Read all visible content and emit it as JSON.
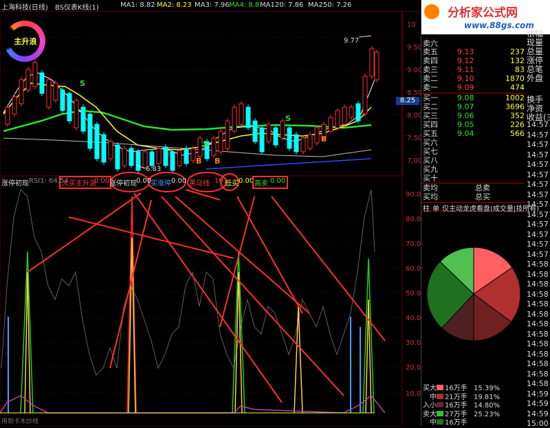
{
  "header": {
    "stock": "上海科技(日线)",
    "indicator": "BS仪表K线(1)",
    "ma1": "MA1: 8.82",
    "ma2": "MA2: 8.23",
    "ma3": "MA3: 7.96",
    "ma4": "MA4: 8.8",
    "ma120": "MA120: 7.86",
    "ma250": "MA250: 7.26"
  },
  "gauge_label": "主升浪",
  "chart_labels": {
    "high": "9.77",
    "low": "6.83",
    "current_price": "8.25",
    "signal_S": "S",
    "signal_B": "B"
  },
  "price_axis": [
    "10",
    "9.50",
    "9.00",
    "8.50",
    "8.00",
    "7.50",
    "7.00"
  ],
  "sub_header": {
    "title": "涨停初现",
    "rsi": "RSI1: 64.54",
    "labels": [
      {
        "text": "大买主升浪",
        "value": "0.00"
      },
      {
        "text": "涨停初现",
        "value": "0.00"
      },
      {
        "text": "买涨停",
        "value": "0.00"
      },
      {
        "text": "黑马线",
        "value": "10"
      },
      {
        "text": "低买",
        "value": "0.00"
      },
      {
        "text": "高卖",
        "value": "0.00"
      }
    ]
  },
  "rsi_axis": [
    "90.00",
    "80.00",
    "70.00",
    "60.00",
    "50.00",
    "40.00",
    "30.00",
    "20.00",
    "10.00"
  ],
  "bottom_text": "用到卡木炒线",
  "watermark": {
    "title": "分析家公式网",
    "url": "www.88gs.com"
  },
  "order_book": {
    "asks": [
      {
        "label": "卖六",
        "price": "",
        "vol": ""
      },
      {
        "label": "卖五",
        "price": "9.13",
        "vol": "237"
      },
      {
        "label": "卖四",
        "price": "9.12",
        "vol": "132"
      },
      {
        "label": "卖三",
        "price": "9.11",
        "vol": "83"
      },
      {
        "label": "卖二",
        "price": "9.10",
        "vol": "1870"
      },
      {
        "label": "卖一",
        "price": "9.09",
        "vol": "474"
      }
    ],
    "bids": [
      {
        "label": "买一",
        "price": "9.08",
        "vol": "1002"
      },
      {
        "label": "买二",
        "price": "9.07",
        "vol": "3696"
      },
      {
        "label": "买三",
        "price": "9.06",
        "vol": "352"
      },
      {
        "label": "买四",
        "price": "9.05",
        "vol": "226"
      },
      {
        "label": "买五",
        "price": "9.04",
        "vol": "566"
      },
      {
        "label": "买六",
        "price": "",
        "vol": ""
      },
      {
        "label": "买七",
        "price": "",
        "vol": ""
      },
      {
        "label": "买八",
        "price": "",
        "vol": ""
      },
      {
        "label": "买九",
        "price": "",
        "vol": ""
      },
      {
        "label": "买十",
        "price": "",
        "vol": ""
      }
    ],
    "sell_avg": "卖均",
    "buy_avg": "买均",
    "total_sell": "总卖",
    "total_buy": "总买"
  },
  "far_right_labels": [
    "依幅",
    "现量",
    "总量",
    "涨停",
    "总笔",
    "外盘",
    "换手",
    "净资",
    "收益(三"
  ],
  "times": [
    "14:57",
    "14:57",
    "14:57",
    "14:57",
    "14:57",
    "14:57",
    "14:57",
    "14:57",
    "14:57",
    "14:57",
    "14:57",
    "14:57",
    "14:57",
    "14:57",
    "14:58",
    "14:58",
    "14:58",
    "14:58",
    "14:58",
    "14:58",
    "14:58",
    "14:58",
    "14:58",
    "14:58",
    "14:58",
    "14:58",
    "14:58",
    "14:59",
    "14:59",
    "14:59",
    "15:00"
  ],
  "tabs": {
    "t1": "柱",
    "t2": "单",
    "t3": "仅主动",
    "t4": "龙虎看盘(成交量|技所有)"
  },
  "pie": [
    {
      "value": 15.39,
      "color": "#ff6060"
    },
    {
      "value": 19.81,
      "color": "#b03030"
    },
    {
      "value": 14.8,
      "color": "#702020"
    },
    {
      "value": 12.0,
      "color": "#502020"
    },
    {
      "value": 25.23,
      "color": "#207020"
    },
    {
      "value": 12.77,
      "color": "#50c050"
    }
  ],
  "legend": {
    "buy_label": "买入",
    "sell_label": "卖",
    "rows": [
      {
        "side": "买",
        "size": "大",
        "lots": "16万手",
        "pct": "15.39%",
        "color": "#ff6060"
      },
      {
        "side": "",
        "size": "中",
        "lots": "21万手",
        "pct": "19.81%",
        "color": "#b03030"
      },
      {
        "side": "入",
        "size": "小",
        "lots": "16万手",
        "pct": "14.80%",
        "color": "#702020"
      },
      {
        "side": "卖",
        "size": "大",
        "lots": "27万手",
        "pct": "25.23%",
        "color": "#30c030"
      },
      {
        "side": "",
        "size": "中",
        "lots": "16万手",
        "pct": "",
        "color": "#207020"
      }
    ]
  },
  "colors": {
    "up": "#ff3030",
    "down": "#00ffff",
    "ma1": "#ffffff",
    "ma2": "#ffff40",
    "ma3": "#ff40ff",
    "ma4": "#30e030"
  }
}
